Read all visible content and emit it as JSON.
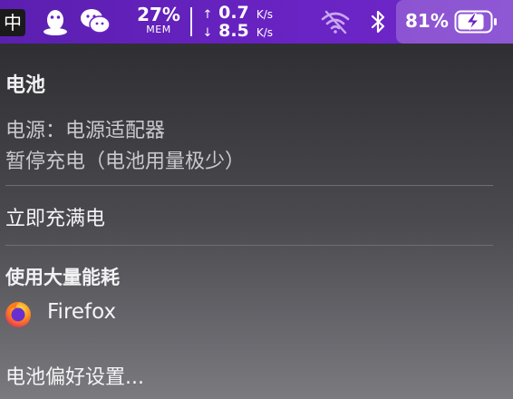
{
  "menubar": {
    "ime_label": "中",
    "memory": {
      "percent": "27%",
      "label": "MEM"
    },
    "network": {
      "up": {
        "value": "0.7",
        "unit": "K/s"
      },
      "down": {
        "value": "8.5",
        "unit": "K/s"
      }
    },
    "battery": {
      "percent": "81%",
      "charging": true
    },
    "icons": [
      "qq-icon",
      "wechat-icon",
      "wifi-off-icon",
      "bluetooth-icon",
      "battery-charging-icon"
    ]
  },
  "battery_menu": {
    "title": "电池",
    "power_source": "电源：电源适配器",
    "charging_status": "暂停充电（电池用量极少）",
    "charge_now": "立即充满电",
    "heavy_usage_header": "使用大量能耗",
    "apps": [
      {
        "name": "Firefox",
        "icon": "firefox-icon"
      }
    ],
    "preferences": "电池偏好设置..."
  },
  "colors": {
    "menubar_purple": "#6a23c4",
    "menu_background": "#3a3a3e"
  }
}
